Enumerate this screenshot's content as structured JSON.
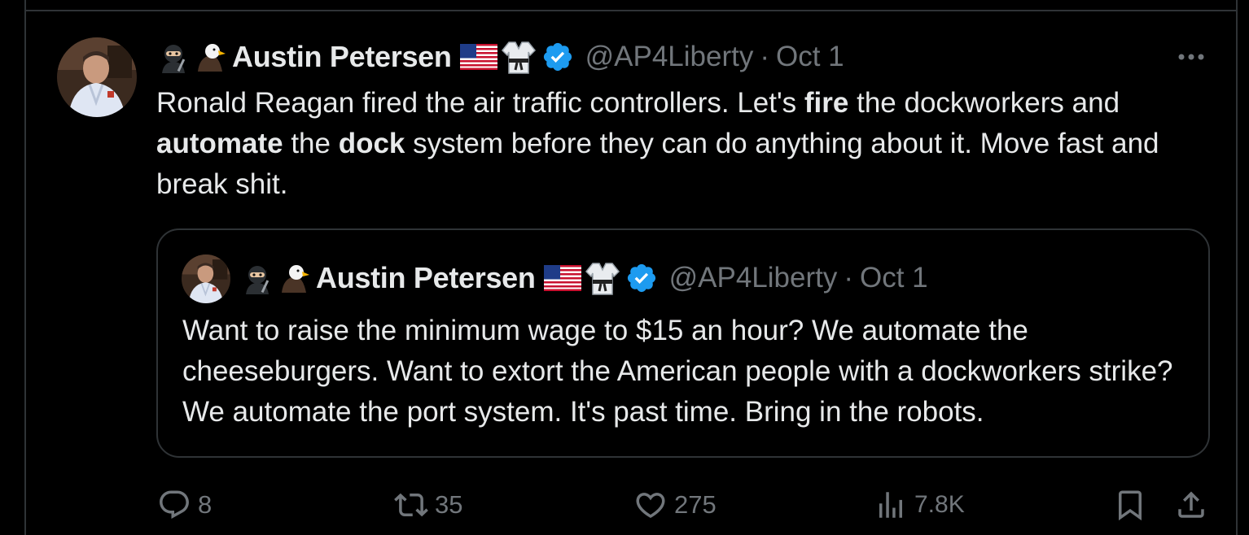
{
  "tweet": {
    "author": {
      "name": "Austin Petersen",
      "handle": "@AP4Liberty",
      "date": "Oct 1",
      "separator": "·",
      "prefix_icons": [
        "ninja-icon",
        "eagle-icon"
      ],
      "suffix_icons": [
        "us-flag-icon",
        "martial-arts-uniform-icon",
        "verified-badge-icon"
      ]
    },
    "text_parts": [
      "Ronald Reagan fired the air traffic controllers. Let's ",
      "fire",
      " the dockworkers and ",
      "automate",
      " the ",
      "dock",
      " system before they can do anything about it. Move fast and break shit."
    ],
    "quoted": {
      "author": {
        "name": "Austin Petersen",
        "handle": "@AP4Liberty",
        "date": "Oct 1",
        "separator": "·"
      },
      "text": "Want to raise the minimum wage to $15 an hour? We automate the cheeseburgers. Want to extort the American people with a dockworkers strike? We automate the port system. It's past time. Bring in the robots."
    },
    "actions": {
      "replies": "8",
      "reposts": "35",
      "likes": "275",
      "views": "7.8K"
    }
  },
  "colors": {
    "background": "#000000",
    "text": "#e7e9ea",
    "secondary": "#71767b",
    "border": "#2f3336",
    "verified": "#1d9bf0"
  }
}
